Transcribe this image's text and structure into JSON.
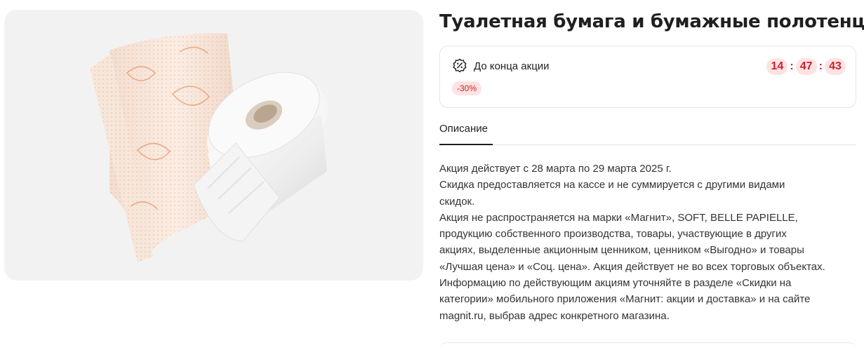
{
  "product": {
    "title": "Туалетная бумага и бумажные полотенца",
    "image_alt": "Рулоны туалетной бумаги и бумажных полотенец"
  },
  "promo": {
    "icon": "percent-badge-icon",
    "label": "До конца акции",
    "discount": "-30%",
    "timer": {
      "hours": "14",
      "minutes": "47",
      "seconds": "43",
      "separator": ":"
    },
    "accent_color": "#d0202c",
    "badge_bg": "#fde3e3"
  },
  "tabs": [
    {
      "label": "Описание",
      "active": true
    }
  ],
  "description": {
    "lines": [
      "Акция действует с 28 марта по 29 марта 2025 г.",
      "Скидка предоставляется на кассе и не суммируется с другими видами",
      "скидок.",
      "Акция не распространяется на марки «Магнит», SOFT, BELLE PAPIELLE,",
      "продукцию собственного производства, товары, участвующие в других",
      "акциях, выделенные акционным ценником, ценником «Выгодно» и товары",
      "«Лучшая цена» и «Соц. цена». Акция действует не во всех торговых объектах.",
      "Информацию по действующим акциям уточняйте в разделе «Скидки на",
      "категории» мобильного приложения «Магнит: акции и доставка» и на сайте",
      "magnit.ru, выбрав адрес конкретного магазина."
    ]
  }
}
